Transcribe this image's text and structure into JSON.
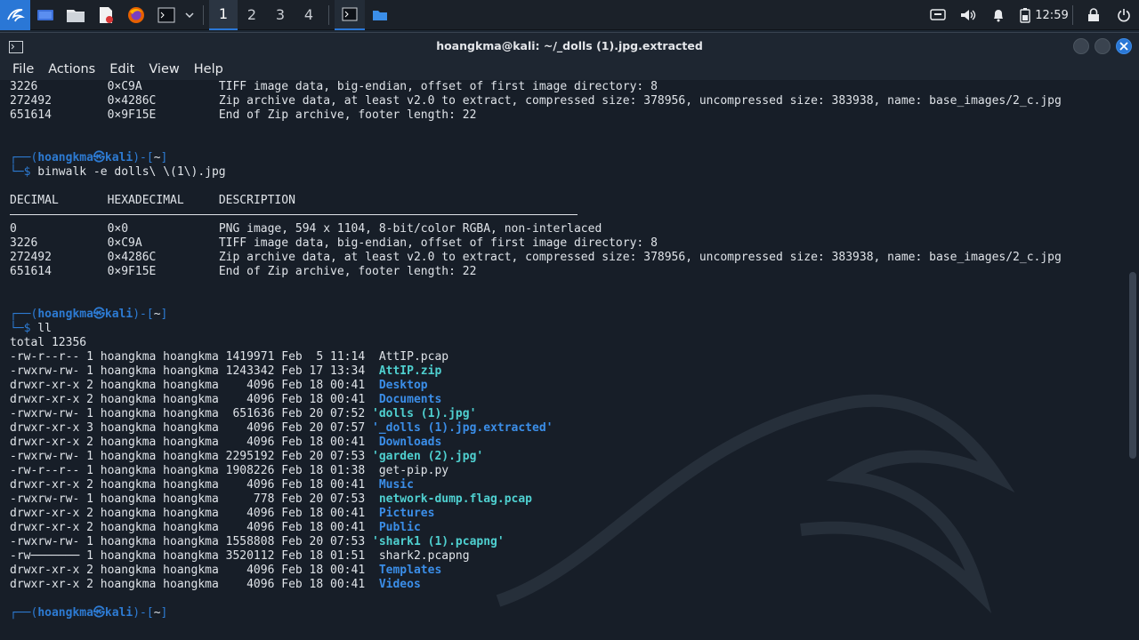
{
  "panel": {
    "workspaces": [
      "1",
      "2",
      "3",
      "4"
    ],
    "clock": "12:59"
  },
  "window": {
    "title": "hoangkma@kali: ~/_dolls (1).jpg.extracted"
  },
  "menu": [
    "File",
    "Actions",
    "Edit",
    "View",
    "Help"
  ],
  "terminal": {
    "top_rows": [
      {
        "dec": "3226",
        "hex": "0×C9A",
        "desc": "TIFF image data, big-endian, offset of first image directory: 8"
      },
      {
        "dec": "272492",
        "hex": "0×4286C",
        "desc": "Zip archive data, at least v2.0 to extract, compressed size: 378956, uncompressed size: 383938, name: base_images/2_c.jpg"
      },
      {
        "dec": "651614",
        "hex": "0×9F15E",
        "desc": "End of Zip archive, footer length: 22"
      }
    ],
    "prompt": {
      "box_open": "┌──(",
      "user": "hoangkma㉿kali",
      "box_close": ")-[",
      "dir": "~",
      "bracket_end": "]",
      "dollar": "└─$"
    },
    "cmd1": " binwalk -e dolls\\ \\(1\\).jpg",
    "headers": {
      "dec": "DECIMAL",
      "hex": "HEXADECIMAL",
      "desc": "DESCRIPTION"
    },
    "rows": [
      {
        "dec": "0",
        "hex": "0×0",
        "desc": "PNG image, 594 x 1104, 8-bit/color RGBA, non-interlaced"
      },
      {
        "dec": "3226",
        "hex": "0×C9A",
        "desc": "TIFF image data, big-endian, offset of first image directory: 8"
      },
      {
        "dec": "272492",
        "hex": "0×4286C",
        "desc": "Zip archive data, at least v2.0 to extract, compressed size: 378956, uncompressed size: 383938, name: base_images/2_c.jpg"
      },
      {
        "dec": "651614",
        "hex": "0×9F15E",
        "desc": "End of Zip archive, footer length: 22"
      }
    ],
    "cmd2": " ll",
    "total": "total 12356",
    "listing": [
      {
        "meta": "-rw-r--r-- 1 hoangkma hoangkma 1419971 Feb  5 11:14 ",
        "name": " AttIP.pcap",
        "style": "plain"
      },
      {
        "meta": "-rwxrw-rw- 1 hoangkma hoangkma 1243342 Feb 17 13:34 ",
        "name": " AttIP.zip",
        "style": "cyan"
      },
      {
        "meta": "drwxr-xr-x 2 hoangkma hoangkma    4096 Feb 18 00:41 ",
        "name": " Desktop",
        "style": "blue"
      },
      {
        "meta": "drwxr-xr-x 2 hoangkma hoangkma    4096 Feb 18 00:41 ",
        "name": " Documents",
        "style": "blue"
      },
      {
        "meta": "-rwxrw-rw- 1 hoangkma hoangkma  651636 Feb 20 07:52 ",
        "name": "'dolls (1).jpg'",
        "style": "cyan"
      },
      {
        "meta": "drwxr-xr-x 3 hoangkma hoangkma    4096 Feb 20 07:57 ",
        "name": "'_dolls (1).jpg.extracted'",
        "style": "blue"
      },
      {
        "meta": "drwxr-xr-x 2 hoangkma hoangkma    4096 Feb 18 00:41 ",
        "name": " Downloads",
        "style": "blue"
      },
      {
        "meta": "-rwxrw-rw- 1 hoangkma hoangkma 2295192 Feb 20 07:53 ",
        "name": "'garden (2).jpg'",
        "style": "cyan"
      },
      {
        "meta": "-rw-r--r-- 1 hoangkma hoangkma 1908226 Feb 18 01:38 ",
        "name": " get-pip.py",
        "style": "plain"
      },
      {
        "meta": "drwxr-xr-x 2 hoangkma hoangkma    4096 Feb 18 00:41 ",
        "name": " Music",
        "style": "blue"
      },
      {
        "meta": "-rwxrw-rw- 1 hoangkma hoangkma     778 Feb 20 07:53 ",
        "name": " network-dump.flag.pcap",
        "style": "cyan"
      },
      {
        "meta": "drwxr-xr-x 2 hoangkma hoangkma    4096 Feb 18 00:41 ",
        "name": " Pictures",
        "style": "blue"
      },
      {
        "meta": "drwxr-xr-x 2 hoangkma hoangkma    4096 Feb 18 00:41 ",
        "name": " Public",
        "style": "blue"
      },
      {
        "meta": "-rwxrw-rw- 1 hoangkma hoangkma 1558808 Feb 20 07:53 ",
        "name": "'shark1 (1).pcapng'",
        "style": "cyan"
      },
      {
        "meta": "-rw─────── 1 hoangkma hoangkma 3520112 Feb 18 01:51 ",
        "name": " shark2.pcapng",
        "style": "plain"
      },
      {
        "meta": "drwxr-xr-x 2 hoangkma hoangkma    4096 Feb 18 00:41 ",
        "name": " Templates",
        "style": "blue"
      },
      {
        "meta": "drwxr-xr-x 2 hoangkma hoangkma    4096 Feb 18 00:41 ",
        "name": " Videos",
        "style": "blue"
      }
    ]
  }
}
